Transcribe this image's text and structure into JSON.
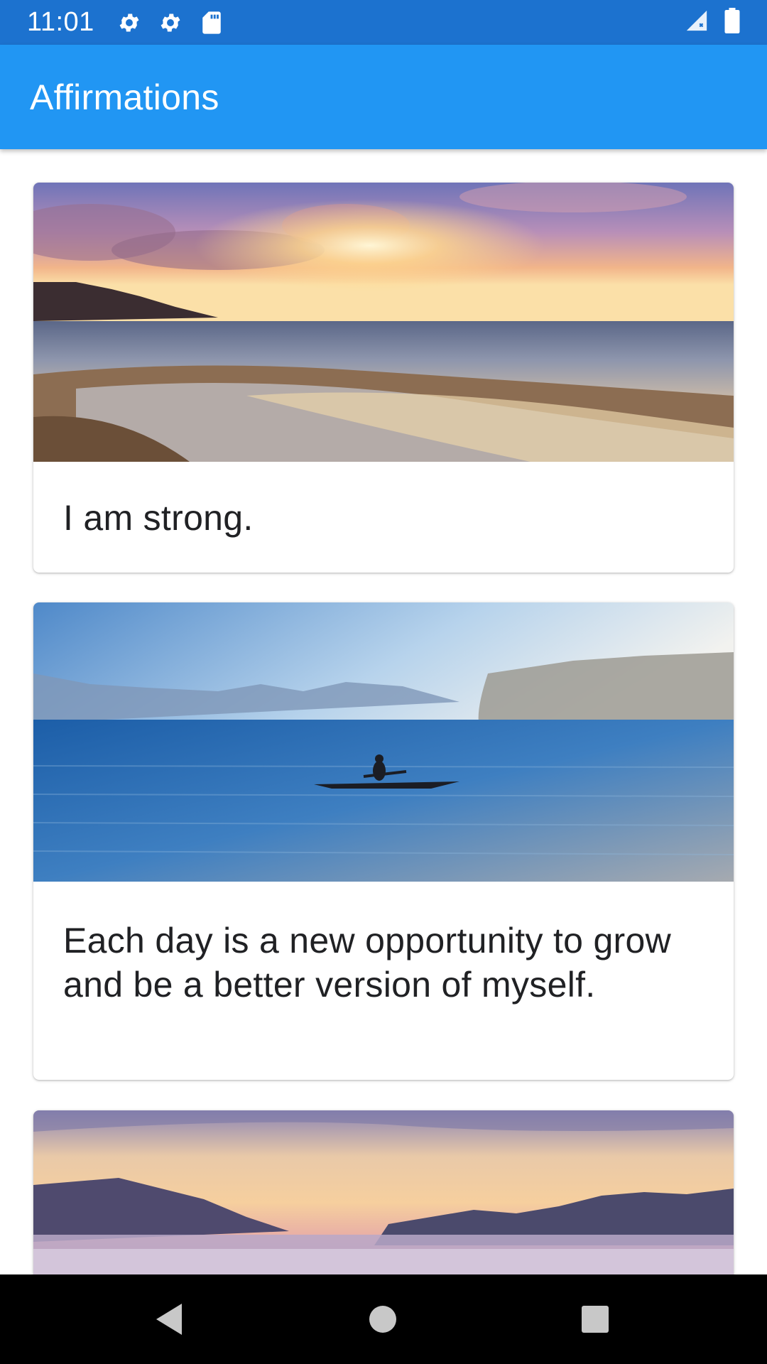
{
  "status_bar": {
    "time": "11:01",
    "icons": [
      "gear-icon",
      "gear-icon",
      "sd-card-icon"
    ],
    "right_icons": [
      "signal-icon",
      "battery-icon"
    ]
  },
  "app_bar": {
    "title": "Affirmations"
  },
  "cards": [
    {
      "text": "I am strong.",
      "image": "beach-sunset-image"
    },
    {
      "text": "Each day is a new opportunity to grow and be a better version of myself.",
      "image": "lake-kayak-image"
    },
    {
      "text": "",
      "image": "mountain-sunset-image"
    }
  ],
  "nav_bar": {
    "buttons": [
      "back-icon",
      "home-icon",
      "recents-icon"
    ]
  },
  "colors": {
    "status_bar": "#1c72cf",
    "app_bar": "#2196f3",
    "nav_bar": "#000000"
  }
}
